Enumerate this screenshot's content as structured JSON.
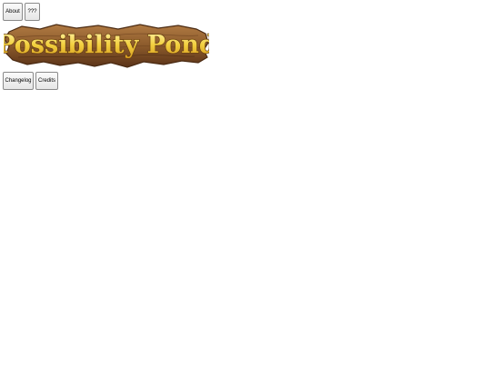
{
  "header": {
    "buttons": {
      "about": "About",
      "unknown": "???"
    }
  },
  "logo": {
    "text": "Possibility Pond"
  },
  "footer_buttons": {
    "changelog": "Changelog",
    "credits": "Credits"
  },
  "colors": {
    "wood_dark": "#5a3319",
    "wood_mid": "#8b5a2b",
    "wood_light": "#b07a43",
    "text_fill": "#f2cf3e",
    "text_stroke": "#6b4210"
  }
}
